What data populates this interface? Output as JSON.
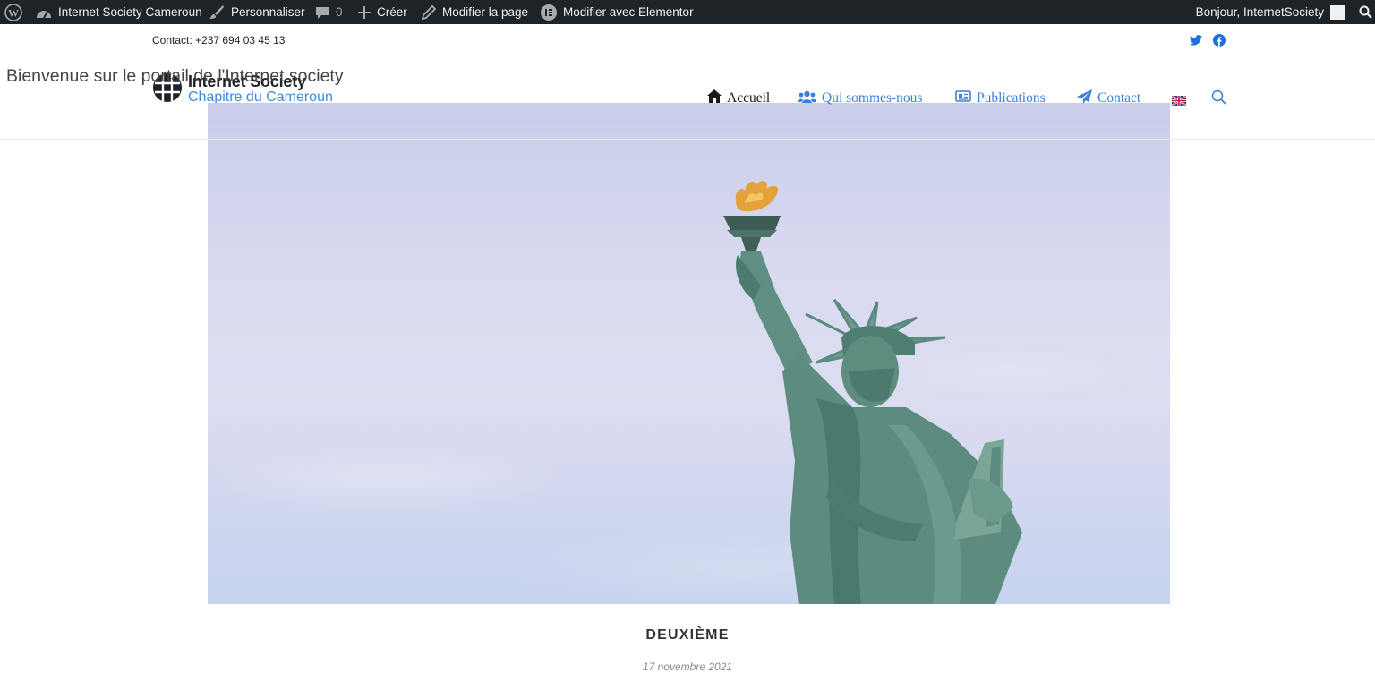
{
  "admin_bar": {
    "site_name": "Internet Society Cameroun",
    "customize": "Personnaliser",
    "comments_count": "0",
    "create": "Créer",
    "edit_page": "Modifier la page",
    "edit_elementor": "Modifier avec Elementor",
    "greeting": "Bonjour, InternetSociety"
  },
  "topbar": {
    "contact": "Contact: +237 694 03 45 13"
  },
  "welcome_text": "Bienvenue sur le portail de l'Internet society",
  "logo": {
    "line1": "Internet Society",
    "line2": "Chapitre du Cameroun"
  },
  "nav": {
    "items": [
      {
        "label": "Accueil",
        "icon": "home-icon"
      },
      {
        "label": "Qui sommes-nous",
        "icon": "users-icon"
      },
      {
        "label": "Publications",
        "icon": "newspaper-icon"
      },
      {
        "label": "Contact",
        "icon": "paper-plane-icon"
      }
    ],
    "language_flag": "uk-flag-icon"
  },
  "colors": {
    "admin_bar_bg": "#1d2327",
    "nav_link": "#3b7fd6",
    "logo_blue": "#3b8dd9"
  },
  "post": {
    "title": "DEUXIÈME",
    "date": "17 novembre 2021"
  }
}
